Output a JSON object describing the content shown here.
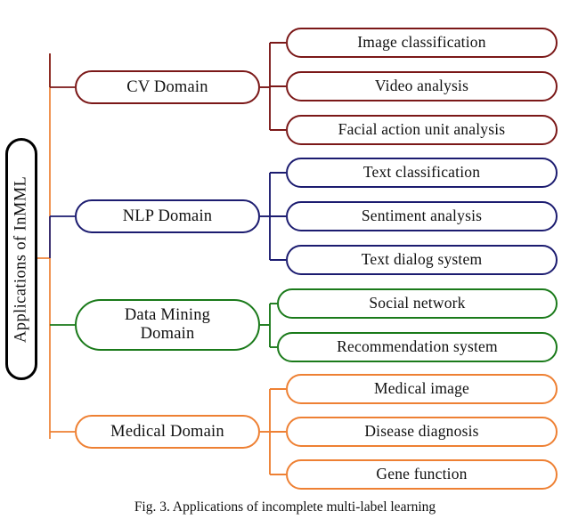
{
  "figure": {
    "caption": "Fig. 3. Applications of incomplete multi-label learning",
    "root": {
      "label": "Applications of InMML",
      "color": "#000000"
    },
    "branches": [
      {
        "id": "cv",
        "label": "CV Domain",
        "color": "#7B1818",
        "leaves": [
          {
            "label": "Image classification"
          },
          {
            "label": "Video analysis"
          },
          {
            "label": "Facial action unit analysis"
          }
        ]
      },
      {
        "id": "nlp",
        "label": "NLP Domain",
        "color": "#1C1C70",
        "leaves": [
          {
            "label": "Text classification"
          },
          {
            "label": "Sentiment analysis"
          },
          {
            "label": "Text dialog system"
          }
        ]
      },
      {
        "id": "data-mining",
        "label": "Data Mining Domain",
        "label_line1": "Data Mining",
        "label_line2": "Domain",
        "color": "#1A7A1A",
        "leaves": [
          {
            "label": "Social network"
          },
          {
            "label": "Recommendation system"
          }
        ]
      },
      {
        "id": "medical",
        "label": "Medical Domain",
        "color": "#EE8033",
        "leaves": [
          {
            "label": "Medical image"
          },
          {
            "label": "Disease diagnosis"
          },
          {
            "label": "Gene function"
          }
        ]
      }
    ]
  }
}
